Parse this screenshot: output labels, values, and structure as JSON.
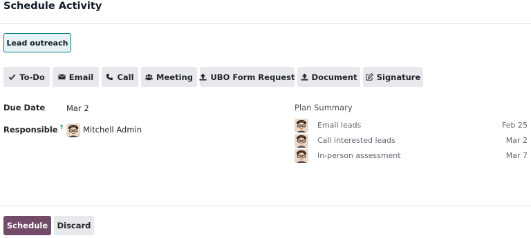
{
  "dialog": {
    "title": "Schedule Activity",
    "plan_button": "Lead outreach"
  },
  "activity_types": [
    {
      "label": "To-Do",
      "icon": "check-icon"
    },
    {
      "label": "Email",
      "icon": "envelope-icon"
    },
    {
      "label": "Call",
      "icon": "phone-icon"
    },
    {
      "label": "Meeting",
      "icon": "users-icon"
    },
    {
      "label": "UBO Form Request",
      "icon": "upload-icon"
    },
    {
      "label": "Document",
      "icon": "upload-icon"
    },
    {
      "label": "Signature",
      "icon": "pencil-square-icon"
    }
  ],
  "fields": {
    "due_date_label": "Due Date",
    "due_date_value": "Mar 2",
    "responsible_label": "Responsible",
    "responsible_help": "?",
    "responsible_value": "Mitchell Admin"
  },
  "plan_summary": {
    "title": "Plan Summary",
    "items": [
      {
        "label": "Email leads",
        "date": "Feb 25"
      },
      {
        "label": "Call interested leads",
        "date": "Mar 2"
      },
      {
        "label": "In-person assessment",
        "date": "Mar 7"
      }
    ]
  },
  "footer": {
    "schedule_label": "Schedule",
    "discard_label": "Discard"
  },
  "colors": {
    "primary": "#714b67",
    "accent": "#017e84",
    "button_gray": "#e7e9ed"
  }
}
